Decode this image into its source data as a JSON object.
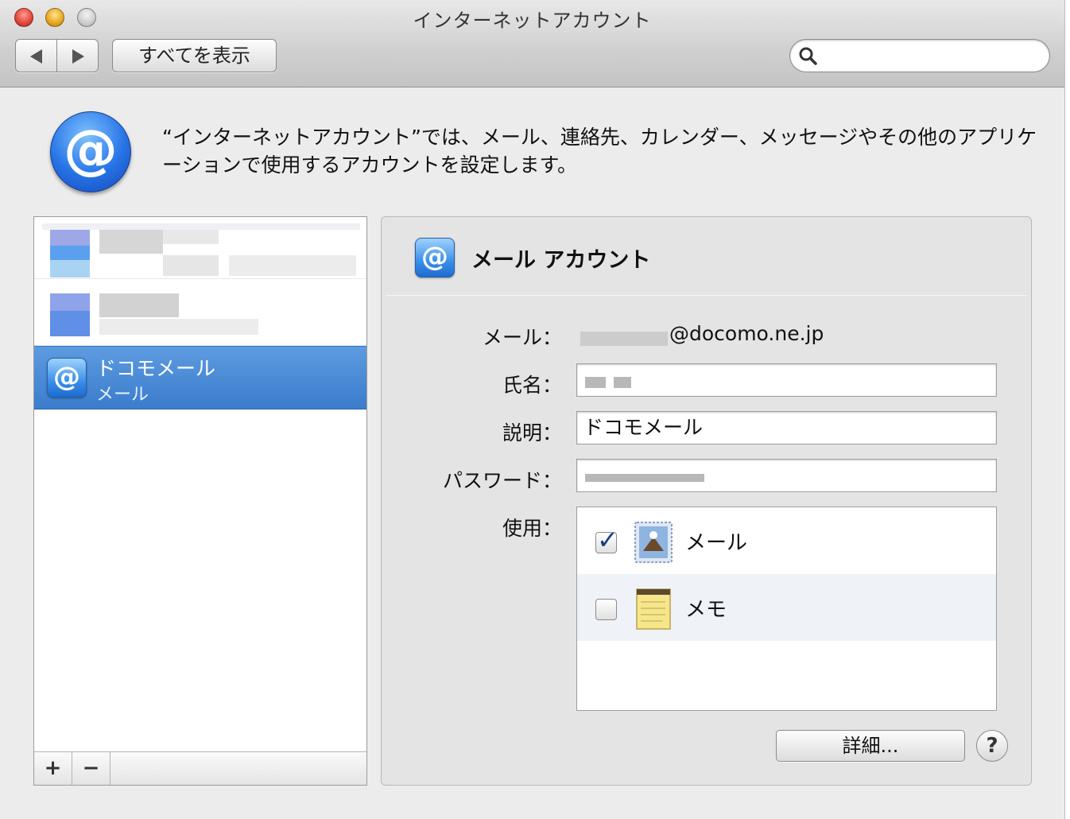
{
  "window": {
    "title": "インターネットアカウント"
  },
  "toolbar": {
    "back_icon": "chevron-left-icon",
    "forward_icon": "chevron-right-icon",
    "show_all_label": "すべてを表示",
    "search": {
      "placeholder": "",
      "value": ""
    }
  },
  "header": {
    "icon": "at-sign-icon",
    "description": "“インターネットアカウント”では、メール、連絡先、カレンダー、メッセージやその他のアプリケーションで使用するアカウントを設定します。"
  },
  "accounts": {
    "selected": {
      "title": "ドコモメール",
      "subtitle": "メール"
    },
    "add_label": "+",
    "remove_label": "−"
  },
  "detail": {
    "title": "メール アカウント",
    "email_label": "メール：",
    "email_value": "@docomo.ne.jp",
    "name_label": "氏名：",
    "description_label": "説明：",
    "description_value": "ドコモメール",
    "password_label": "パスワード：",
    "use_label": "使用：",
    "apps": [
      {
        "label": "メール",
        "checked": true,
        "icon": "mail-stamp-icon"
      },
      {
        "label": "メモ",
        "checked": false,
        "icon": "notes-pad-icon"
      }
    ],
    "details_button": "詳細...",
    "help_button": "?"
  },
  "colors": {
    "selection": "#3b7ccc",
    "accent": "#2673e6"
  }
}
